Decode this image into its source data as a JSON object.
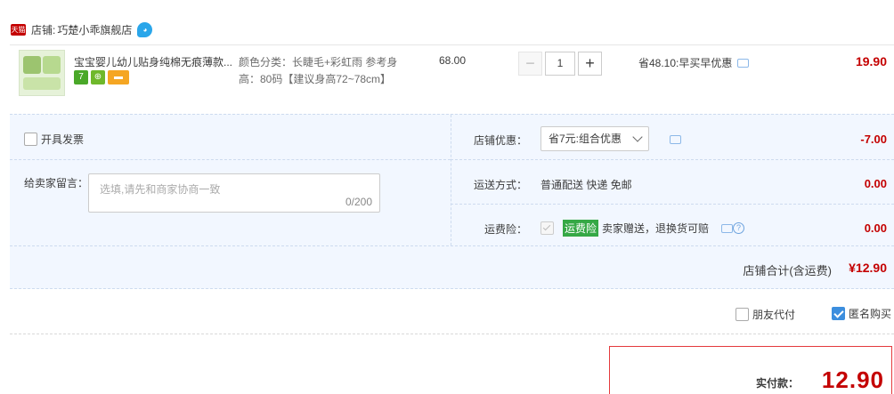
{
  "shop": {
    "badge": "天猫",
    "label": "店铺:",
    "name": "巧楚小乖旗舰店"
  },
  "item": {
    "title": "宝宝婴儿幼儿贴身纯棉无痕薄款...",
    "service_icons": [
      "seven-day-return-icon",
      "guarantee-icon",
      "card-pay-icon"
    ],
    "sku": "颜色分类：长睫毛+彩虹雨 参考身高：80码【建议身高72~78cm】",
    "unit_price": "68.00",
    "quantity": "1",
    "qty_minus": "−",
    "qty_plus": "+",
    "discount": "省48.10:早买早优惠",
    "total": "19.90"
  },
  "options": {
    "invoice_label": "开具发票",
    "message_label": "给卖家留言：",
    "message_placeholder": "选填,请先和商家协商一致",
    "message_count": "0/200",
    "shop_coupon_label": "店铺优惠：",
    "shop_coupon_value": "省7元:组合优惠",
    "shop_coupon_amount": "-7.00",
    "shipping_label": "运送方式：",
    "shipping_value": "普通配送 快递 免邮",
    "shipping_amount": "0.00",
    "insurance_label": "运费险：",
    "insurance_tag": "运费险",
    "insurance_value": "卖家赠送，退换货可赔",
    "insurance_amount": "0.00",
    "subtotal_label": "店铺合计(含运费)",
    "subtotal_amount": "¥12.90"
  },
  "extras": {
    "friend_pay_label": "朋友代付",
    "anonymous_label": "匿名购买"
  },
  "payment": {
    "label": "实付款：",
    "amount": "12.90"
  },
  "colors": {
    "price_red": "#c40000",
    "panel_blue": "#f2f7ff",
    "checkbox_blue": "#3c8ede",
    "insurance_green": "#35a845"
  }
}
